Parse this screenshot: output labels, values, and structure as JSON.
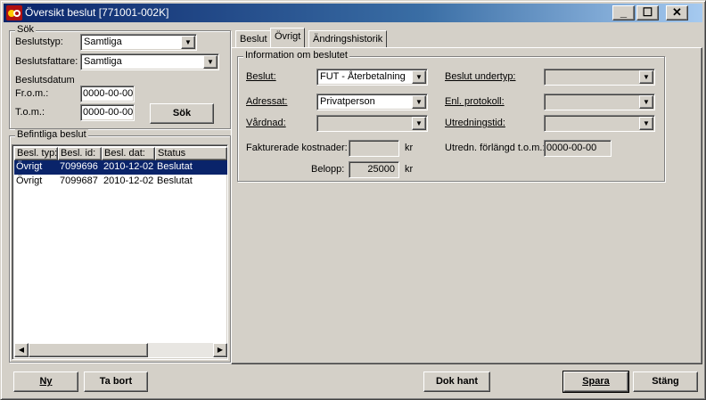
{
  "window": {
    "title": "Översikt beslut",
    "title_id": "[771001-002K]",
    "minimize_label": "_",
    "maximize_label": "☐",
    "close_label": "✕"
  },
  "search": {
    "group_label": "Sök",
    "beslutstyp_label": "Beslutstyp:",
    "beslutstyp_value": "Samtliga",
    "beslutsfattare_label": "Beslutsfattare:",
    "beslutsfattare_value": "Samtliga",
    "beslutsdatum_label": "Beslutsdatum",
    "from_label": "Fr.o.m.:",
    "from_value": "0000-00-00",
    "tom_label": "T.o.m.:",
    "tom_value": "0000-00-00",
    "search_button": "Sök"
  },
  "existing": {
    "group_label": "Befintliga beslut",
    "columns": [
      "Besl. typ:",
      "Besl. id:",
      "Besl. dat:",
      "Status"
    ],
    "rows": [
      {
        "typ": "Övrigt",
        "id": "7099696",
        "dat": "2010-12-02",
        "status": "Beslutat",
        "selected": true
      },
      {
        "typ": "Övrigt",
        "id": "7099687",
        "dat": "2010-12-02",
        "status": "Beslutat",
        "selected": false
      }
    ]
  },
  "tabs": [
    {
      "label": "Beslut",
      "active": false
    },
    {
      "label": "Övrigt",
      "active": true
    },
    {
      "label": "Ändringshistorik",
      "active": false
    }
  ],
  "info": {
    "group_label": "Information om beslutet",
    "beslut_label": "Beslut:",
    "beslut_value": "FUT - Återbetalning",
    "adressat_label": "Adressat:",
    "adressat_value": "Privatperson",
    "vardnad_label": "Vårdnad:",
    "vardnad_value": "",
    "fakturerade_label": "Fakturerade kostnader:",
    "fakturerade_value": "",
    "kr_label": "kr",
    "belopp_label": "Belopp:",
    "belopp_value": "25000",
    "kr_label2": "kr",
    "undertyp_label": "Beslut undertyp:",
    "undertyp_value": "",
    "protokoll_label": "Enl. protokoll:",
    "protokoll_value": "",
    "utredningstid_label": "Utredningstid:",
    "utredningstid_value": "",
    "forlangd_label": "Utredn. förlängd t.o.m.:",
    "forlangd_value": "0000-00-00"
  },
  "buttons": {
    "ny": "Ny",
    "ta_bort": "Ta bort",
    "dok_hant": "Dok hant",
    "spara": "Spara",
    "stang": "Stäng"
  },
  "colors": {
    "selection": "#0a246a",
    "face": "#d4d0c8"
  }
}
